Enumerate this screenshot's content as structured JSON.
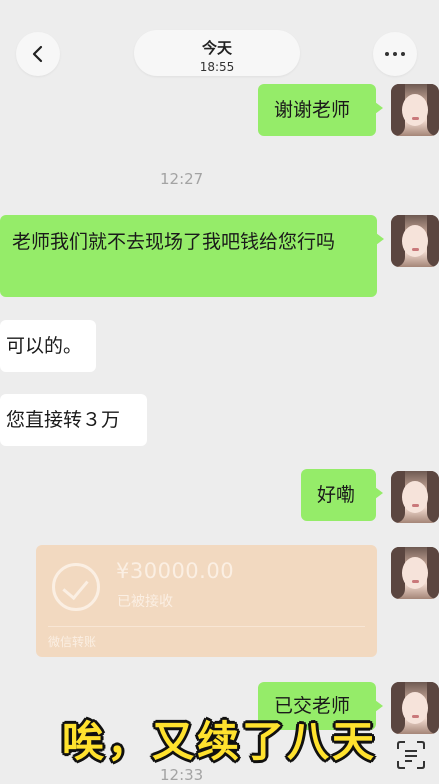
{
  "header": {
    "date_label": "今天",
    "time_label": "18:55"
  },
  "messages": [
    {
      "text": "谢谢老师"
    },
    {
      "timestamp": "12:27"
    },
    {
      "text": "老师我们就不去现场了我吧钱给您行吗"
    },
    {
      "text": "可以的。"
    },
    {
      "text": "您直接转３万"
    },
    {
      "text": "好嘞"
    },
    {
      "transfer": {
        "amount": "¥30000.00",
        "status": "已被接收",
        "footer": "微信转账"
      }
    },
    {
      "text": "已交老师"
    },
    {
      "timestamp": "12:33"
    }
  ],
  "caption": "唉，又续了八天",
  "colors": {
    "background": "#ededed",
    "my_bubble": "#95ec69",
    "other_bubble": "#ffffff",
    "transfer_card": "#f2d9c0",
    "caption_text": "#ffe22e"
  },
  "icons": [
    "back-arrow-icon",
    "more-dots-icon",
    "check-circle-icon",
    "scan-icon"
  ]
}
